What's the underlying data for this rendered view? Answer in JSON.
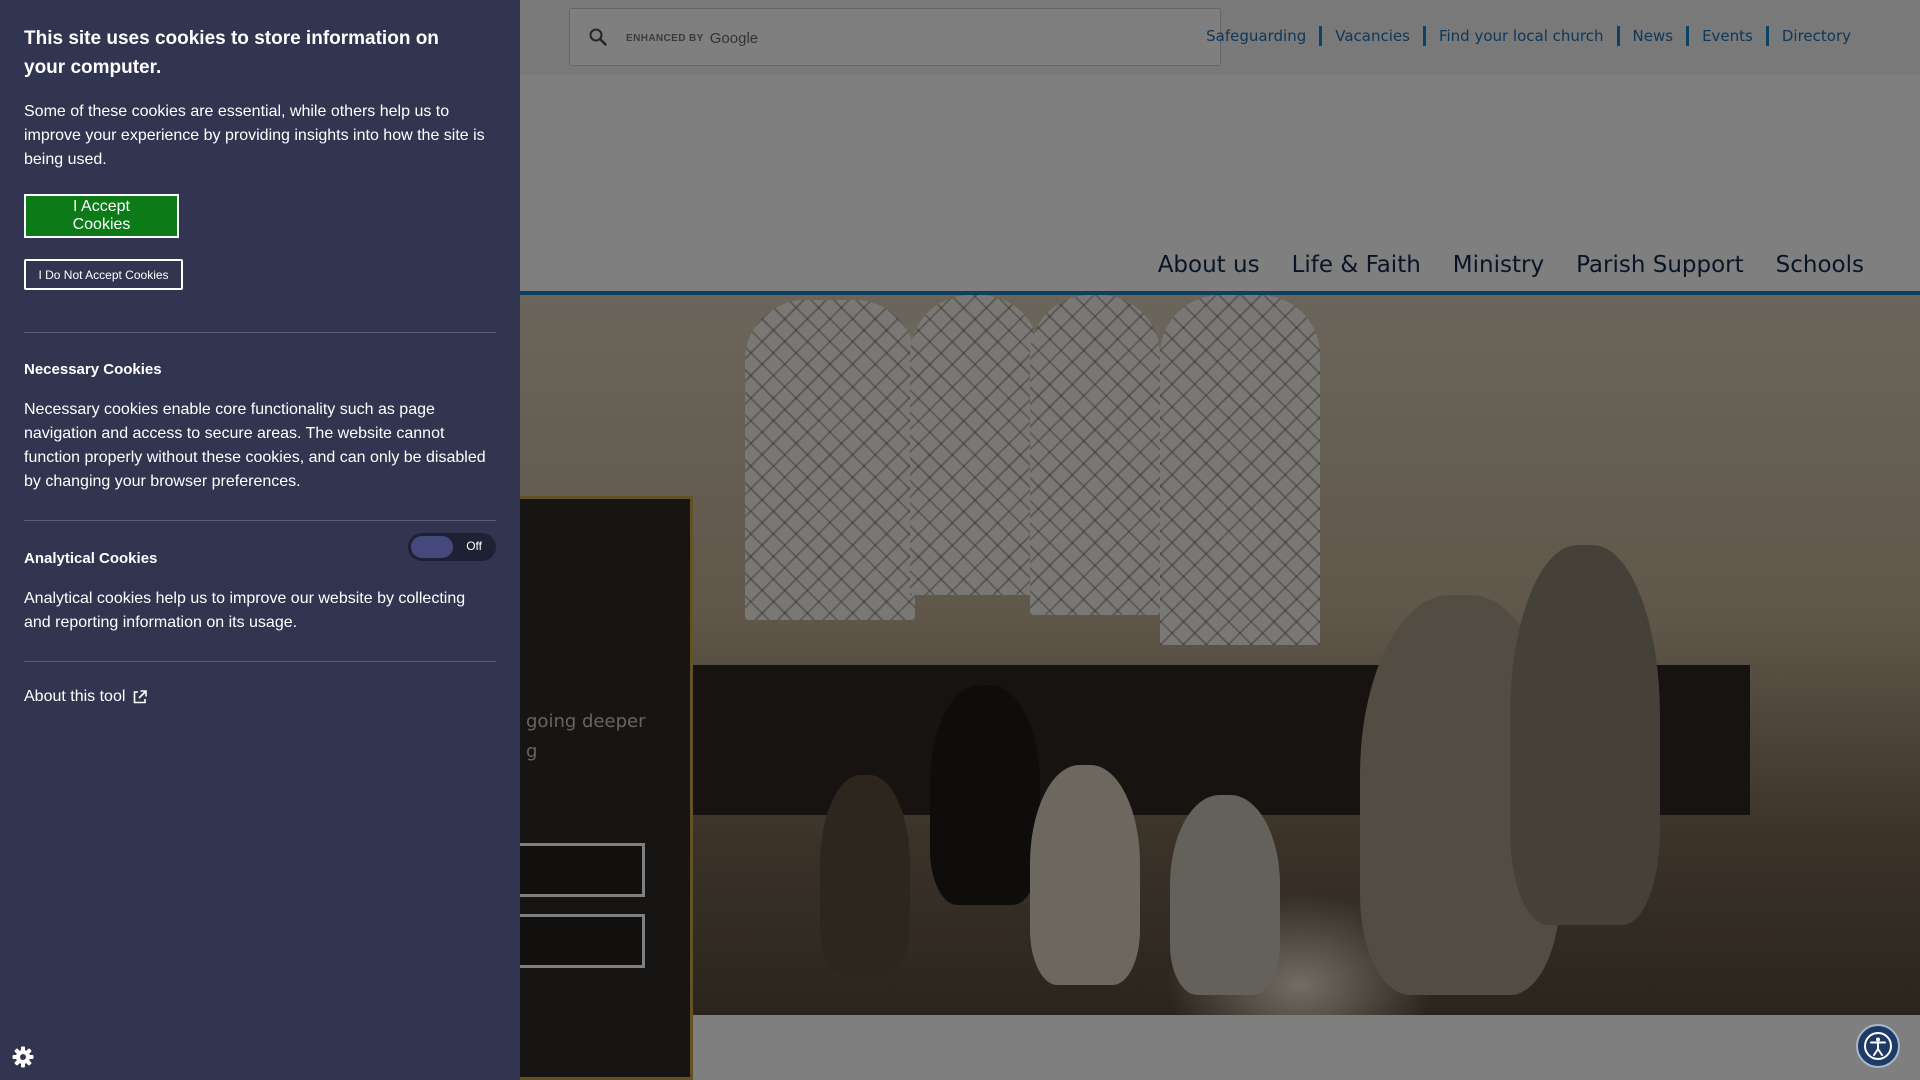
{
  "search": {
    "placeholder": "",
    "branding_enhanced": "ENHANCED BY",
    "branding_google": "Google"
  },
  "utility_nav": [
    "Safeguarding",
    "Vacancies",
    "Find your local church",
    "News",
    "Events",
    "Directory"
  ],
  "main_nav": [
    "About us",
    "Life & Faith",
    "Ministry",
    "Parish Support",
    "Schools"
  ],
  "hero_card": {
    "text_line1": "going deeper",
    "text_line2": "g"
  },
  "cookie": {
    "title": "This site uses cookies to store information on your computer.",
    "intro": "Some of these cookies are essential, while others help us to improve your experience by providing insights into how the site is being used.",
    "accept_label": "I Accept Cookies",
    "reject_label": "I Do Not Accept Cookies",
    "necessary_title": "Necessary Cookies",
    "necessary_text": "Necessary cookies enable core functionality such as page navigation and access to secure areas. The website cannot function properly without these cookies, and can only be disabled by changing your browser preferences.",
    "analytical_title": "Analytical Cookies",
    "analytical_toggle_state": "Off",
    "analytical_text": "Analytical cookies help us to improve our website by collecting and reporting information on its usage.",
    "about_label": "About this tool"
  },
  "colors": {
    "panel_bg": "#313550",
    "accept_green": "#0b7a17",
    "link_blue": "#1c6fb5",
    "nav_navy": "#13294b",
    "card_gold": "#c8a24a"
  },
  "icons": {
    "search": "search-icon",
    "external": "external-link-icon",
    "cookie_settings": "cookie-gear-icon",
    "accessibility": "accessibility-icon"
  }
}
